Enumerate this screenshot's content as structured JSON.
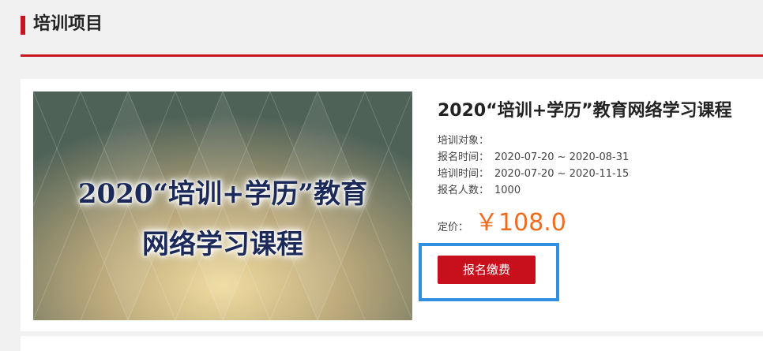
{
  "section": {
    "title": "培训项目"
  },
  "course": {
    "cover_line1": "2020“培训+学历”教育",
    "cover_line2": "网络学习课程",
    "title": "2020“培训+学历”教育网络学习课程",
    "meta": [
      {
        "label": "培训对象：",
        "value": ""
      },
      {
        "label": "报名时间：",
        "value": "2020-07-20 ~ 2020-08-31"
      },
      {
        "label": "培训时间：",
        "value": "2020-07-20 ~ 2020-11-15"
      },
      {
        "label": "报名人数：",
        "value": "1000"
      }
    ],
    "price_label": "定价：",
    "price": "￥108.0",
    "enroll_button": "报名缴费"
  },
  "colors": {
    "accent_red": "#c8141e",
    "price_orange": "#f26a1b",
    "highlight_blue": "#2f8fe0"
  }
}
